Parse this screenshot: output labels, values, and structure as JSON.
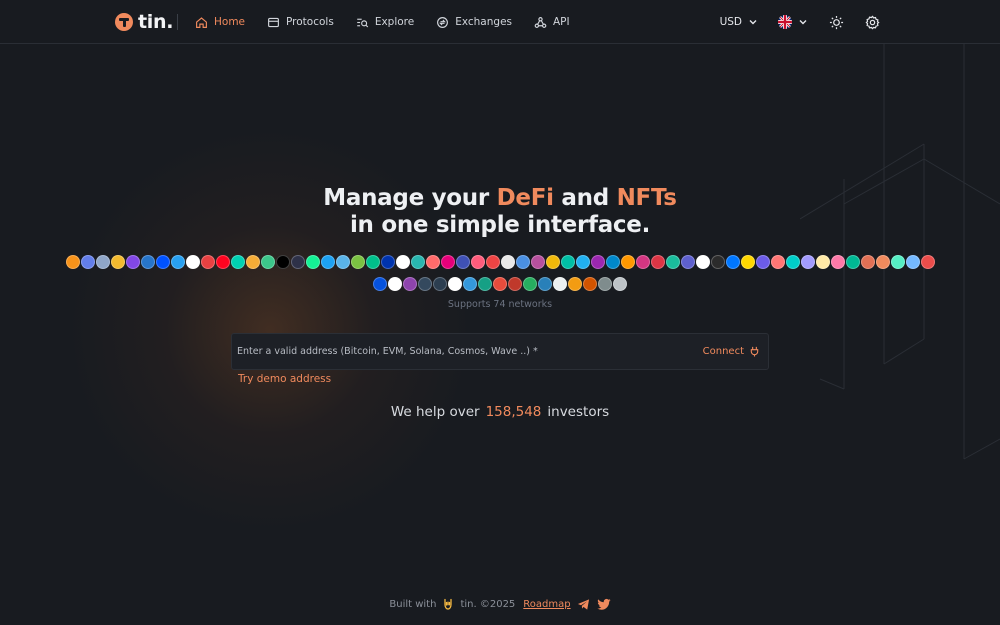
{
  "brand": {
    "name": "tin.",
    "color": "#f08a5d"
  },
  "nav": [
    {
      "label": "Home",
      "icon": "home-icon",
      "active": true
    },
    {
      "label": "Protocols",
      "icon": "protocols-icon",
      "active": false
    },
    {
      "label": "Explore",
      "icon": "explore-icon",
      "active": false
    },
    {
      "label": "Exchanges",
      "icon": "exchanges-icon",
      "active": false
    },
    {
      "label": "API",
      "icon": "api-icon",
      "active": false
    }
  ],
  "currency": {
    "value": "USD"
  },
  "language": {
    "flag": "uk-flag-icon"
  },
  "hero": {
    "line1_pre": "Manage your",
    "accent1": "DeFi",
    "line1_mid": "and",
    "accent2": "NFTs",
    "line2": "in one simple interface."
  },
  "networks": {
    "supports_text": "Supports 74 networks",
    "row1_colors": [
      "#f7931a",
      "#627eea",
      "#8fa6c8",
      "#f3ba2f",
      "#8247e5",
      "#2775ca",
      "#0052ff",
      "#28a0f0",
      "#ffffff",
      "#e84142",
      "#ff0420",
      "#00d1b2",
      "#f5ac37",
      "#3cc68a",
      "#000000",
      "#2e3148",
      "#14f195",
      "#1da1f2",
      "#5ab3e8",
      "#7bc142",
      "#00c08b",
      "#0033ad",
      "#ffffff",
      "#29b6af",
      "#ff6b6b",
      "#e6007a",
      "#3f51b5",
      "#ff5c7c",
      "#ee4444",
      "#e8e8e8",
      "#4a90e2",
      "#b6509e",
      "#f0b90b",
      "#00bfa5",
      "#21b0f0",
      "#9c27b0",
      "#0088cc",
      "#ff9800",
      "#d33682",
      "#dc3545",
      "#1abc9c",
      "#5e60ce",
      "#ffffff",
      "#2b2b2b",
      "#0077ff",
      "#ffd700",
      "#6c5ce7",
      "#ff7675",
      "#00cec9",
      "#a29bfe",
      "#ffeaa7",
      "#fd79a8",
      "#00b894",
      "#e17055",
      "#f08a5d",
      "#55efc4",
      "#74b9ff",
      "#eb4d4b"
    ],
    "row2_colors": [
      "#0652dd",
      "#ffffff",
      "#8e44ad",
      "#34495e",
      "#2c3e50",
      "#ffffff",
      "#3498db",
      "#16a085",
      "#e74c3c",
      "#c0392b",
      "#27ae60",
      "#2980b9",
      "#ecf0f1",
      "#f39c12",
      "#d35400",
      "#7f8c8d",
      "#bdc3c7"
    ]
  },
  "address": {
    "placeholder": "Enter a valid address (Bitcoin, EVM, Solana, Cosmos, Wave ..) *",
    "connect_label": "Connect",
    "demo_label": "Try demo address"
  },
  "investors": {
    "pre": "We help over",
    "count": "158,548",
    "post": "investors"
  },
  "footer": {
    "built_pre": "Built with",
    "built_post": "tin. ©2025",
    "roadmap_label": "Roadmap"
  }
}
